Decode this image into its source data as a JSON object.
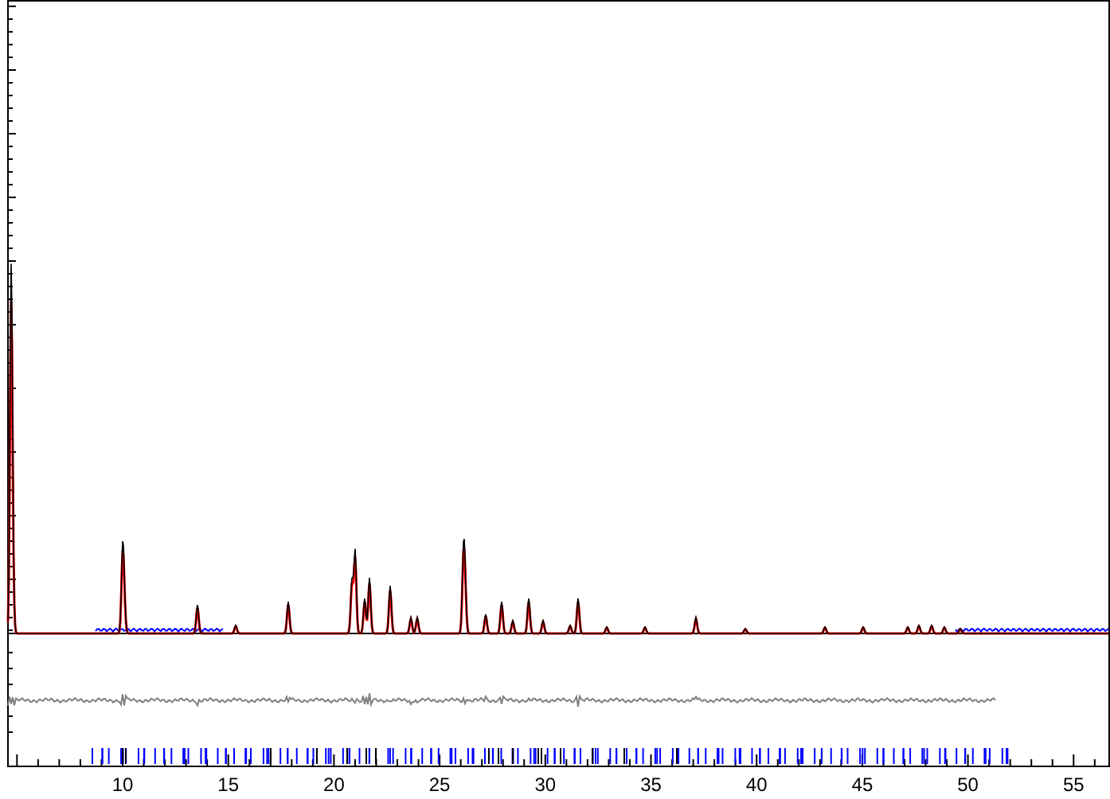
{
  "plot": {
    "x_tick_labels": [
      "10",
      "15",
      "20",
      "25",
      "30",
      "35",
      "40",
      "45",
      "50",
      "55"
    ]
  }
}
